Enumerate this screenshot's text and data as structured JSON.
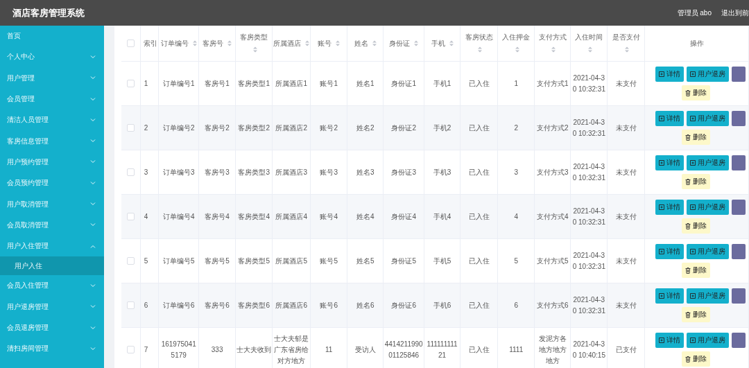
{
  "header": {
    "title": "酒店客房管理系统",
    "user": "管理员 abo",
    "exit": "退出到前"
  },
  "sidebar": {
    "items": [
      {
        "label": "首页",
        "expandable": false
      },
      {
        "label": "个人中心",
        "expandable": true,
        "expanded": false
      },
      {
        "label": "用户管理",
        "expandable": true,
        "expanded": false
      },
      {
        "label": "会员管理",
        "expandable": true,
        "expanded": false
      },
      {
        "label": "清洁人员管理",
        "expandable": true,
        "expanded": false
      },
      {
        "label": "客房信息管理",
        "expandable": true,
        "expanded": false
      },
      {
        "label": "用户预约管理",
        "expandable": true,
        "expanded": false
      },
      {
        "label": "会员预约管理",
        "expandable": true,
        "expanded": false
      },
      {
        "label": "用户取消管理",
        "expandable": true,
        "expanded": false
      },
      {
        "label": "会员取消管理",
        "expandable": true,
        "expanded": false
      },
      {
        "label": "用户入住管理",
        "expandable": true,
        "expanded": true,
        "children": [
          {
            "label": "用户入住",
            "selected": true
          }
        ]
      },
      {
        "label": "会员入住管理",
        "expandable": true,
        "expanded": false
      },
      {
        "label": "用户退房管理",
        "expandable": true,
        "expanded": false
      },
      {
        "label": "会员退房管理",
        "expandable": true,
        "expanded": false
      },
      {
        "label": "清扫房间管理",
        "expandable": true,
        "expanded": false
      }
    ]
  },
  "table": {
    "select_all": {
      "checked": false
    },
    "columns": [
      {
        "label": "索引",
        "sortable": false
      },
      {
        "label": "订单编号",
        "sortable": true
      },
      {
        "label": "客房号",
        "sortable": true
      },
      {
        "label": "客房类型",
        "sortable": true
      },
      {
        "label": "所属酒店",
        "sortable": true
      },
      {
        "label": "账号",
        "sortable": true
      },
      {
        "label": "姓名",
        "sortable": true
      },
      {
        "label": "身份证",
        "sortable": true
      },
      {
        "label": "手机",
        "sortable": true
      },
      {
        "label": "客房状态",
        "sortable": true
      },
      {
        "label": "入住押金",
        "sortable": true
      },
      {
        "label": "支付方式",
        "sortable": true
      },
      {
        "label": "入住时间",
        "sortable": true
      },
      {
        "label": "是否支付",
        "sortable": true
      },
      {
        "label": "操作",
        "sortable": false
      }
    ],
    "rows": [
      {
        "checked": false,
        "cells": [
          "1",
          "订单编号1",
          "客房号1",
          "客房类型1",
          "所属酒店1",
          "账号1",
          "姓名1",
          "身份证1",
          "手机1",
          "已入住",
          "1",
          "支付方式1",
          "2021-04-30 10:32:31",
          "未支付"
        ],
        "actions": [
          {
            "kind": "detail",
            "label": "详情"
          },
          {
            "kind": "checkout",
            "label": "用户退房"
          },
          {
            "kind": "cut"
          },
          {
            "kind": "delete",
            "label": "删除"
          }
        ]
      },
      {
        "checked": false,
        "cells": [
          "2",
          "订单编号2",
          "客房号2",
          "客房类型2",
          "所属酒店2",
          "账号2",
          "姓名2",
          "身份证2",
          "手机2",
          "已入住",
          "2",
          "支付方式2",
          "2021-04-30 10:32:31",
          "未支付"
        ],
        "actions": [
          {
            "kind": "detail",
            "label": "详情"
          },
          {
            "kind": "checkout",
            "label": "用户退房"
          },
          {
            "kind": "cut"
          },
          {
            "kind": "delete",
            "label": "删除"
          }
        ]
      },
      {
        "checked": false,
        "cells": [
          "3",
          "订单编号3",
          "客房号3",
          "客房类型3",
          "所属酒店3",
          "账号3",
          "姓名3",
          "身份证3",
          "手机3",
          "已入住",
          "3",
          "支付方式3",
          "2021-04-30 10:32:31",
          "未支付"
        ],
        "actions": [
          {
            "kind": "detail",
            "label": "详情"
          },
          {
            "kind": "checkout",
            "label": "用户退房"
          },
          {
            "kind": "cut"
          },
          {
            "kind": "delete",
            "label": "删除"
          }
        ]
      },
      {
        "checked": false,
        "cells": [
          "4",
          "订单编号4",
          "客房号4",
          "客房类型4",
          "所属酒店4",
          "账号4",
          "姓名4",
          "身份证4",
          "手机4",
          "已入住",
          "4",
          "支付方式4",
          "2021-04-30 10:32:31",
          "未支付"
        ],
        "actions": [
          {
            "kind": "detail",
            "label": "详情"
          },
          {
            "kind": "checkout",
            "label": "用户退房"
          },
          {
            "kind": "cut"
          },
          {
            "kind": "delete",
            "label": "删除"
          }
        ]
      },
      {
        "checked": false,
        "cells": [
          "5",
          "订单编号5",
          "客房号5",
          "客房类型5",
          "所属酒店5",
          "账号5",
          "姓名5",
          "身份证5",
          "手机5",
          "已入住",
          "5",
          "支付方式5",
          "2021-04-30 10:32:31",
          "未支付"
        ],
        "actions": [
          {
            "kind": "detail",
            "label": "详情"
          },
          {
            "kind": "checkout",
            "label": "用户退房"
          },
          {
            "kind": "cut"
          },
          {
            "kind": "delete",
            "label": "删除"
          }
        ]
      },
      {
        "checked": false,
        "cells": [
          "6",
          "订单编号6",
          "客房号6",
          "客房类型6",
          "所属酒店6",
          "账号6",
          "姓名6",
          "身份证6",
          "手机6",
          "已入住",
          "6",
          "支付方式6",
          "2021-04-30 10:32:31",
          "未支付"
        ],
        "actions": [
          {
            "kind": "detail",
            "label": "详情"
          },
          {
            "kind": "checkout",
            "label": "用户退房"
          },
          {
            "kind": "cut"
          },
          {
            "kind": "delete",
            "label": "删除"
          }
        ]
      },
      {
        "checked": false,
        "cells": [
          "7",
          "1619750415179",
          "333",
          "士大夫收到",
          "士大夫郁是广东省房给对方地方",
          "11",
          "受访人",
          "441421199001125846",
          "11111111121",
          "已入住",
          "1111",
          "发泥方各地方地方地方",
          "2021-04-30 10:40:15",
          "已支付"
        ],
        "actions": [
          {
            "kind": "detail",
            "label": "详情"
          },
          {
            "kind": "checkout",
            "label": "用户退房"
          },
          {
            "kind": "cut"
          },
          {
            "kind": "delete",
            "label": "删除"
          }
        ]
      }
    ]
  }
}
